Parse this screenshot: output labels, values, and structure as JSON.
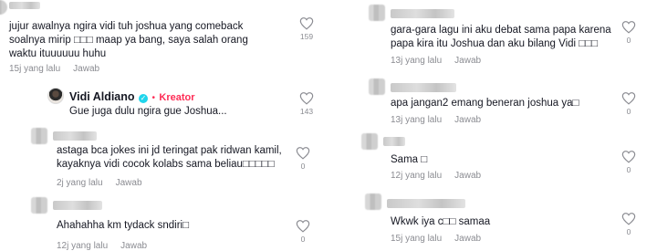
{
  "left": {
    "c1": {
      "text": "jujur awalnya ngira vidi tuh joshua yang comeback\nsoalnya mirip □□□ maap ya bang, saya salah orang\nwaktu ituuuuuu huhu",
      "time": "15j yang lalu",
      "reply": "Jawab",
      "likes": "159"
    },
    "c2": {
      "author": "Vidi Aldiano",
      "badge": "Kreator",
      "text": "Gue juga dulu ngira gue Joshua...",
      "likes": "143"
    },
    "c3": {
      "text": "astaga bca jokes ini jd teringat pak ridwan kamil,\nkayaknya vidi cocok kolabs sama beliau□□□□□",
      "time": "2j yang lalu",
      "reply": "Jawab",
      "likes": "0"
    },
    "c4": {
      "text": "Ahahahha km tydack sndiri□",
      "time": "12j yang lalu",
      "reply": "Jawab",
      "likes": "0"
    }
  },
  "right": {
    "c1": {
      "text": "gara-gara lagu ini aku debat sama papa karena\npapa kira itu Joshua dan aku bilang Vidi □□□",
      "time": "13j yang lalu",
      "reply": "Jawab",
      "likes": "0"
    },
    "c2": {
      "text": "apa jangan2 emang beneran joshua ya□",
      "time": "13j yang lalu",
      "reply": "Jawab",
      "likes": "0"
    },
    "c3": {
      "text": "Sama □",
      "time": "12j yang lalu",
      "reply": "Jawab",
      "likes": "0"
    },
    "c4": {
      "text": "Wkwk iya c□□ samaa",
      "time": "15j yang lalu",
      "reply": "Jawab",
      "likes": "0"
    }
  },
  "icons": {
    "like": "heart-outline-icon",
    "verified": "verified-check-icon"
  },
  "colors": {
    "creator": "#fe2c55",
    "meta": "#8a8b91",
    "verified": "#20d5ec"
  }
}
